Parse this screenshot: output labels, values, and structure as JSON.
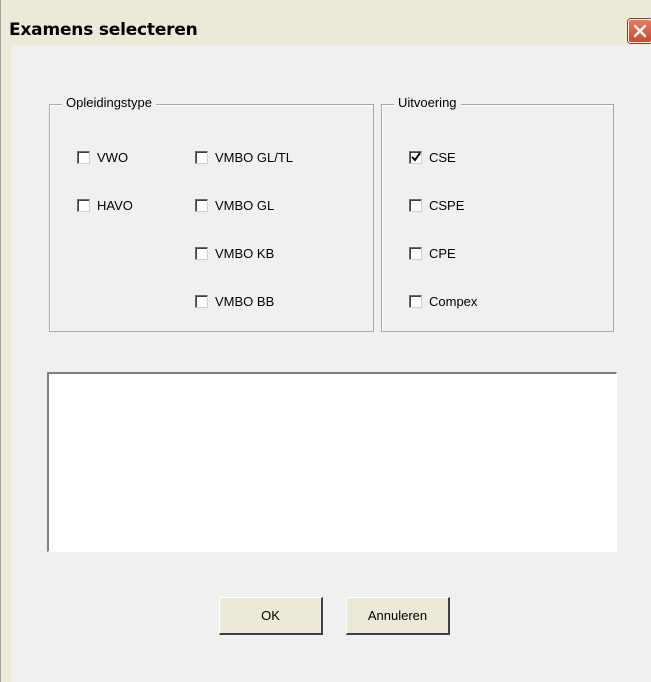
{
  "window": {
    "title": "Examens selecteren"
  },
  "opleidingstype": {
    "legend": "Opleidingstype",
    "options": [
      {
        "label": "VWO",
        "checked": false
      },
      {
        "label": "HAVO",
        "checked": false
      },
      {
        "label": "VMBO GL/TL",
        "checked": false
      },
      {
        "label": "VMBO GL",
        "checked": false
      },
      {
        "label": "VMBO KB",
        "checked": false
      },
      {
        "label": "VMBO BB",
        "checked": false
      }
    ]
  },
  "uitvoering": {
    "legend": "Uitvoering",
    "options": [
      {
        "label": "CSE",
        "checked": true
      },
      {
        "label": "CSPE",
        "checked": false
      },
      {
        "label": "CPE",
        "checked": false
      },
      {
        "label": "Compex",
        "checked": false
      }
    ]
  },
  "results": {
    "value": ""
  },
  "buttons": {
    "ok_label": "OK",
    "cancel_label": "Annuleren"
  },
  "icons": {
    "close": "close-icon",
    "check": "checkmark-icon"
  }
}
